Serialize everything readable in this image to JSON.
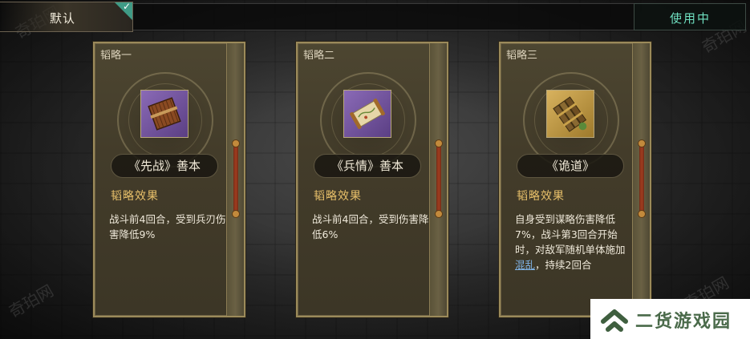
{
  "top_bar": {
    "default_tab_label": "默认",
    "status_badge": "使用中"
  },
  "cards": [
    {
      "title": "韬略一",
      "item_name": "《先战》善本",
      "icon": "bamboo-scroll-icon",
      "frame_color": "#7a5aa8",
      "effect_heading": "韬略效果",
      "effect_text": "战斗前4回合，受到兵刃伤害降低9%"
    },
    {
      "title": "韬略二",
      "item_name": "《兵情》善本",
      "icon": "paper-scroll-icon",
      "frame_color": "#7a5aa8",
      "effect_heading": "韬略效果",
      "effect_text": "战斗前4回合，受到伤害降低6%"
    },
    {
      "title": "韬略三",
      "item_name": "《诡道》",
      "icon": "bamboo-scroll-gold-icon",
      "frame_color": "#c9a24a",
      "effect_heading": "韬略效果",
      "effect_text_pre": "自身受到谋略伤害降低7%，战斗第3回合开始时，对敌军随机单体施加",
      "effect_link": "混乱",
      "effect_text_post": "，持续2回合"
    }
  ],
  "site_logo": {
    "text": "二货游戏园"
  },
  "watermark": "奇珀网"
}
